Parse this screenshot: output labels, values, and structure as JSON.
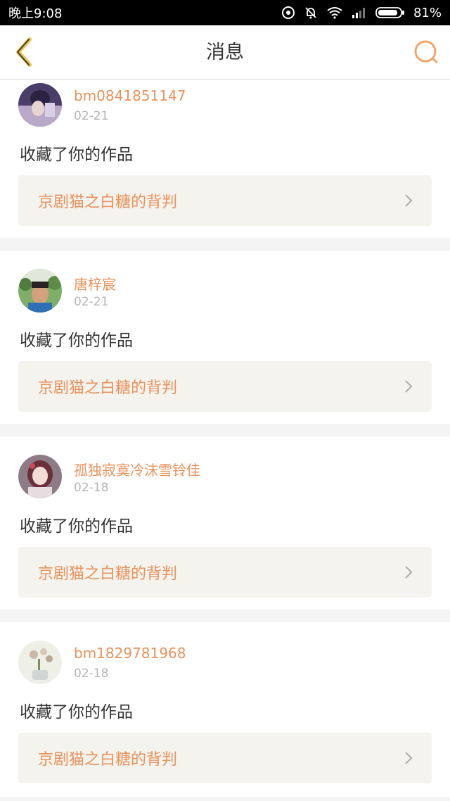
{
  "status_bar": {
    "time": "晚上9:08",
    "battery": "81%"
  },
  "navbar": {
    "title": "消息",
    "back_icon": "chevron-left-icon",
    "search_icon": "search-icon",
    "accent_color": "#e8925d"
  },
  "messages": [
    {
      "username": "bm0841851147",
      "date": "02-21",
      "action": "收藏了你的作品",
      "work_title": "京剧猫之白糖的背判"
    },
    {
      "username": "唐梓宸",
      "date": "02-21",
      "action": "收藏了你的作品",
      "work_title": "京剧猫之白糖的背判"
    },
    {
      "username": "孤独寂寞冷沫雪铃佳",
      "date": "02-18",
      "action": "收藏了你的作品",
      "work_title": "京剧猫之白糖的背判"
    },
    {
      "username": "bm1829781968",
      "date": "02-18",
      "action": "收藏了你的作品",
      "work_title": "京剧猫之白糖的背判"
    }
  ]
}
